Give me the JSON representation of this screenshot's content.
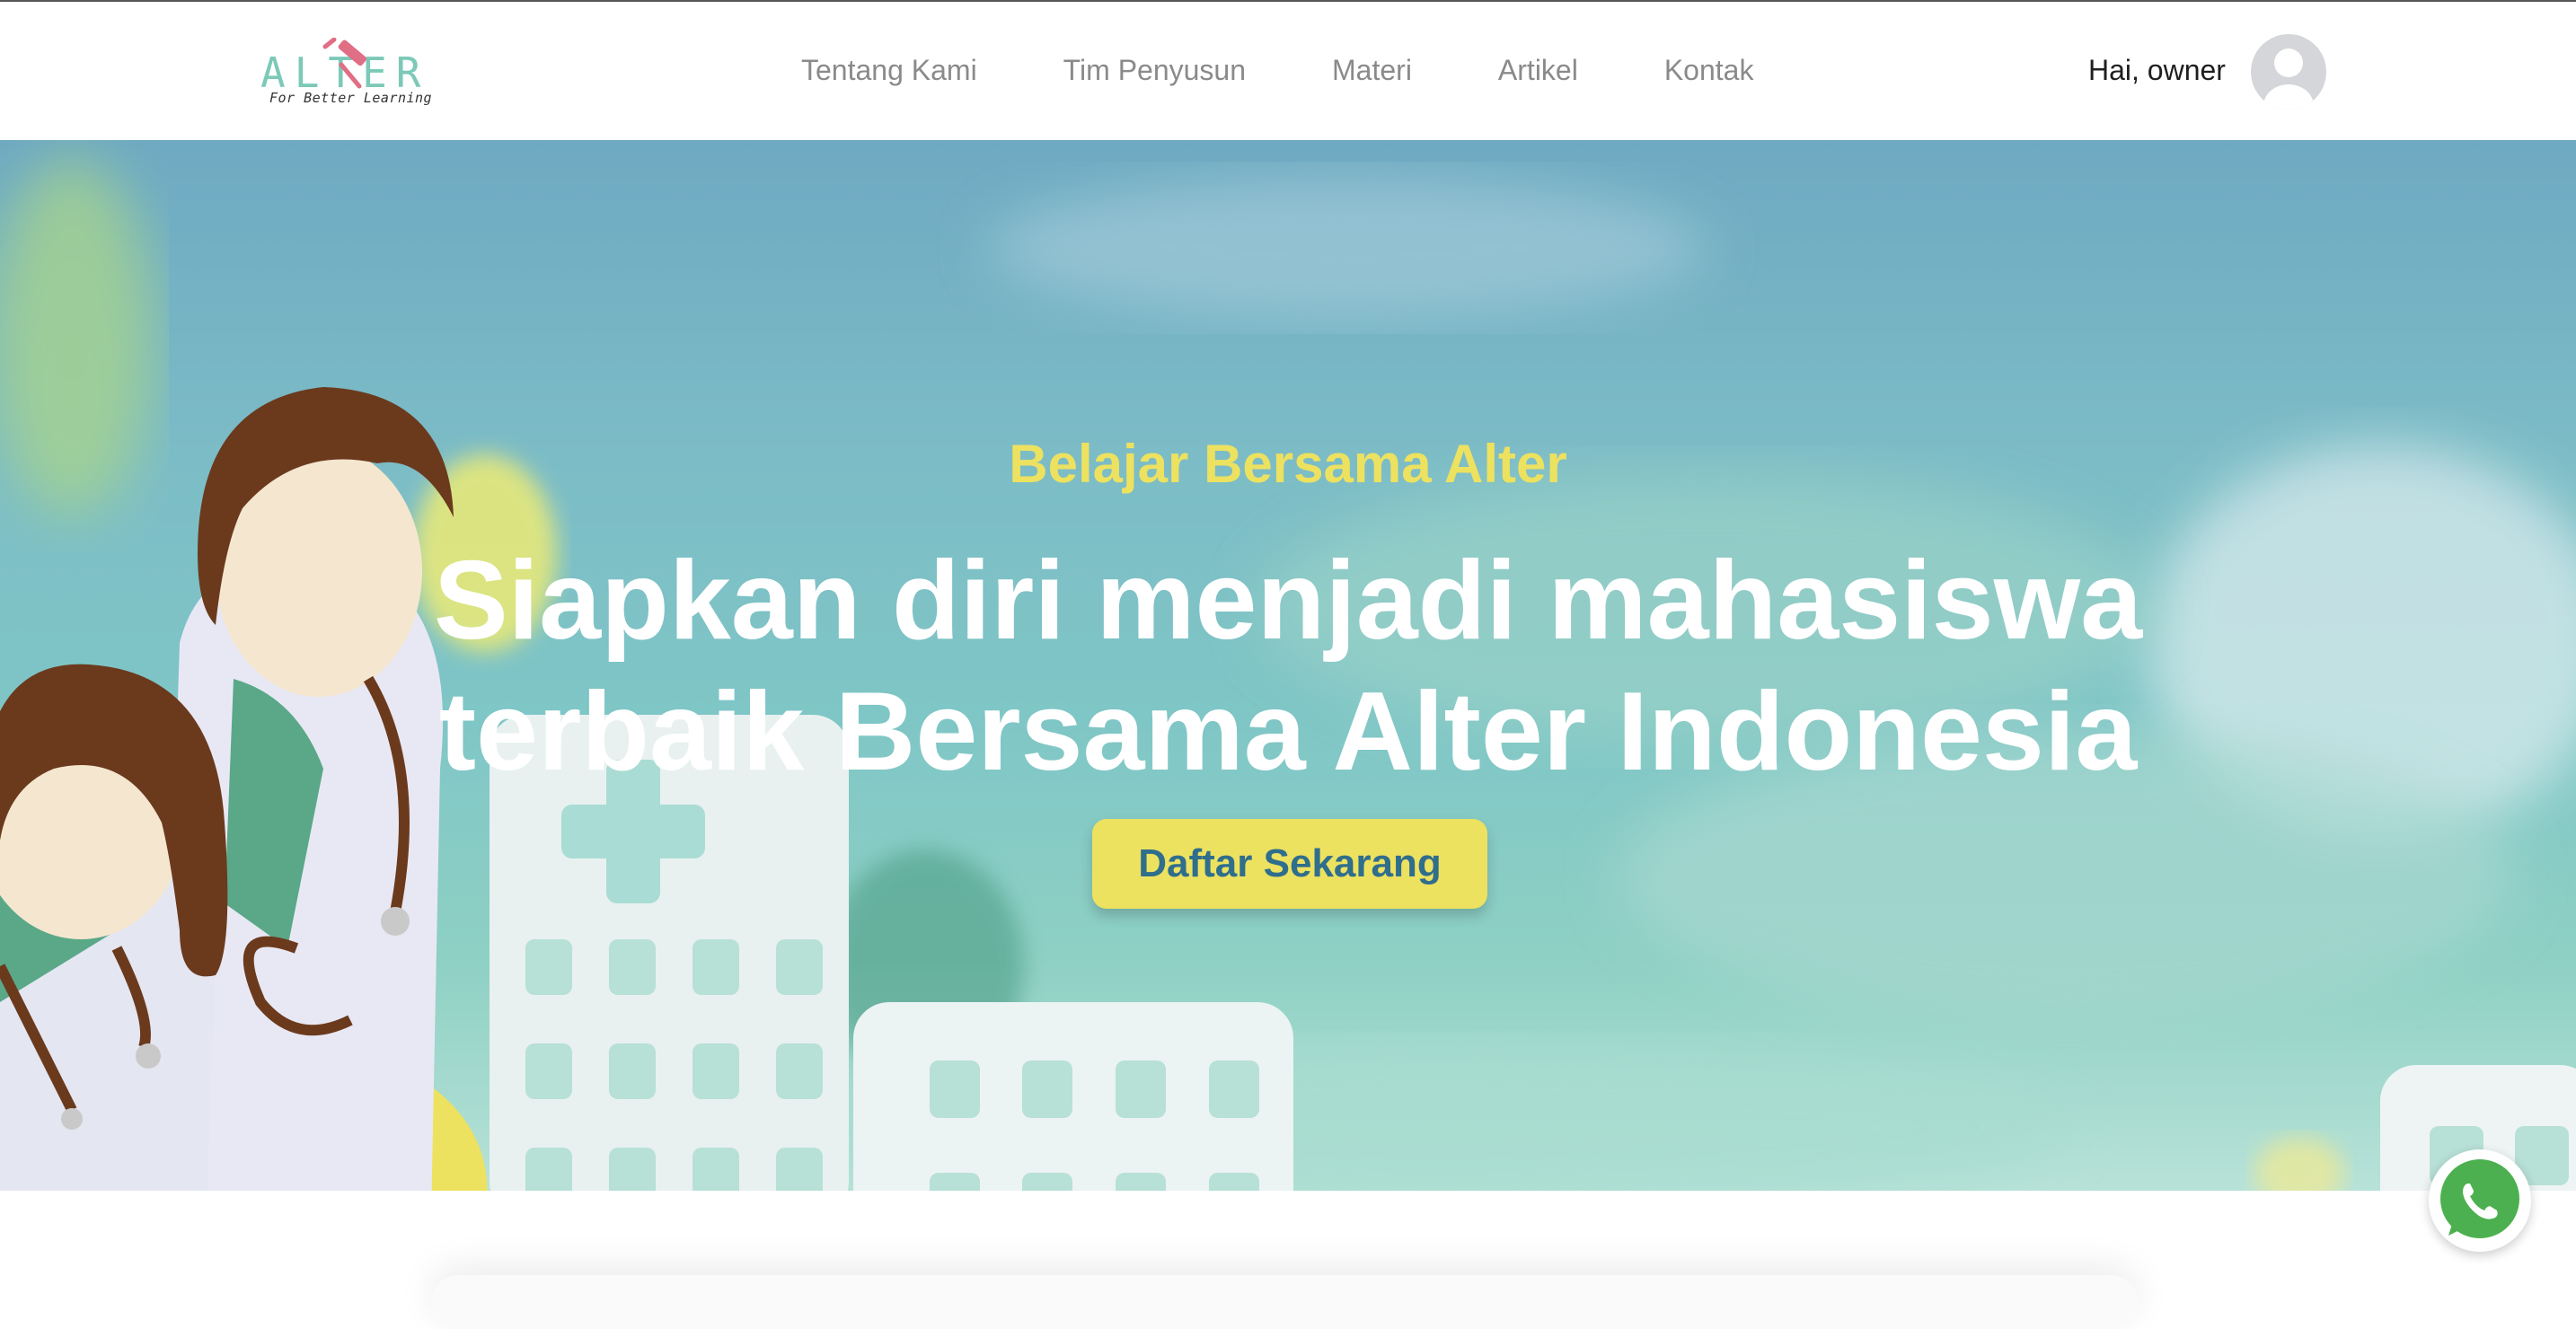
{
  "logo": {
    "text": "ALTER",
    "tagline": "For Better Learning"
  },
  "nav": {
    "links": [
      {
        "label": "Tentang Kami"
      },
      {
        "label": "Tim Penyusun"
      },
      {
        "label": "Materi"
      },
      {
        "label": "Artikel"
      },
      {
        "label": "Kontak"
      }
    ]
  },
  "user": {
    "greeting": "Hai, owner",
    "avatar_icon": "user-avatar-icon"
  },
  "hero": {
    "subtitle": "Belajar Bersama Alter",
    "title_line1": "Siapkan diri menjadi mahasiswa",
    "title_line2": "terbaik Bersama Alter Indonesia",
    "cta_label": "Daftar Sekarang"
  },
  "floating": {
    "whatsapp_icon": "whatsapp-icon"
  },
  "colors": {
    "accent_yellow": "#ede160",
    "brand_teal": "#7cc9b8",
    "cta_text": "#2f6e8c",
    "whatsapp_green": "#4cb050"
  }
}
